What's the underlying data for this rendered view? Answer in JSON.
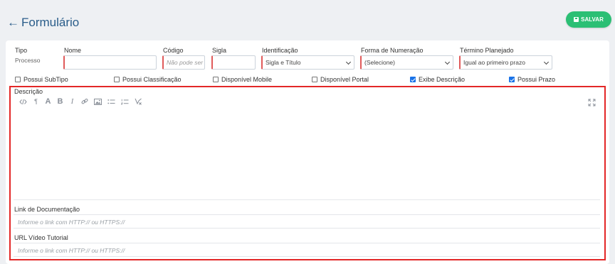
{
  "header": {
    "back_arrow": "←",
    "title": "Formulário",
    "save_label": "SALVAR"
  },
  "form": {
    "tipo": {
      "label": "Tipo",
      "value": "Processo"
    },
    "nome": {
      "label": "Nome",
      "value": ""
    },
    "codigo": {
      "label": "Código",
      "placeholder": "Não pode ser"
    },
    "sigla": {
      "label": "Sigla",
      "value": ""
    },
    "identificacao": {
      "label": "Identificação",
      "value": "Sigla e Título"
    },
    "numeracao": {
      "label": "Forma de Numeração",
      "value": "(Selecione)"
    },
    "termino": {
      "label": "Término Planejado",
      "value": "Igual ao primeiro prazo"
    }
  },
  "checkboxes": [
    {
      "label": "Possui SubTipo",
      "checked": false
    },
    {
      "label": "Possui Classificação",
      "checked": false
    },
    {
      "label": "Disponível Mobile",
      "checked": false
    },
    {
      "label": "Disponível Portal",
      "checked": false
    },
    {
      "label": "Exibe Descrição",
      "checked": true
    },
    {
      "label": "Possui Prazo",
      "checked": true
    }
  ],
  "descricao": {
    "label": "Descrição",
    "toolbar_icons": [
      "code-view-icon",
      "paragraph-icon",
      "font-size-icon",
      "bold-icon",
      "italic-icon",
      "link-icon",
      "image-icon",
      "bullet-list-icon",
      "numbered-list-icon",
      "clear-format-icon",
      "fullscreen-icon"
    ],
    "tb_paragraph": "¶",
    "tb_font": "A",
    "tb_bold": "B",
    "tb_italic": "I"
  },
  "link_doc": {
    "label": "Link de Documentação",
    "placeholder": "Informe o link com HTTP:// ou HTTPS://"
  },
  "url_video": {
    "label": "URL Vídeo Tutorial",
    "placeholder": "Informe o link com HTTP:// ou HTTPS://"
  },
  "colors": {
    "accent": "#2a5d8a",
    "save": "#2bbf74",
    "required": "#e05a5a",
    "highlight": "#e32727",
    "checked": "#1a73e8"
  }
}
